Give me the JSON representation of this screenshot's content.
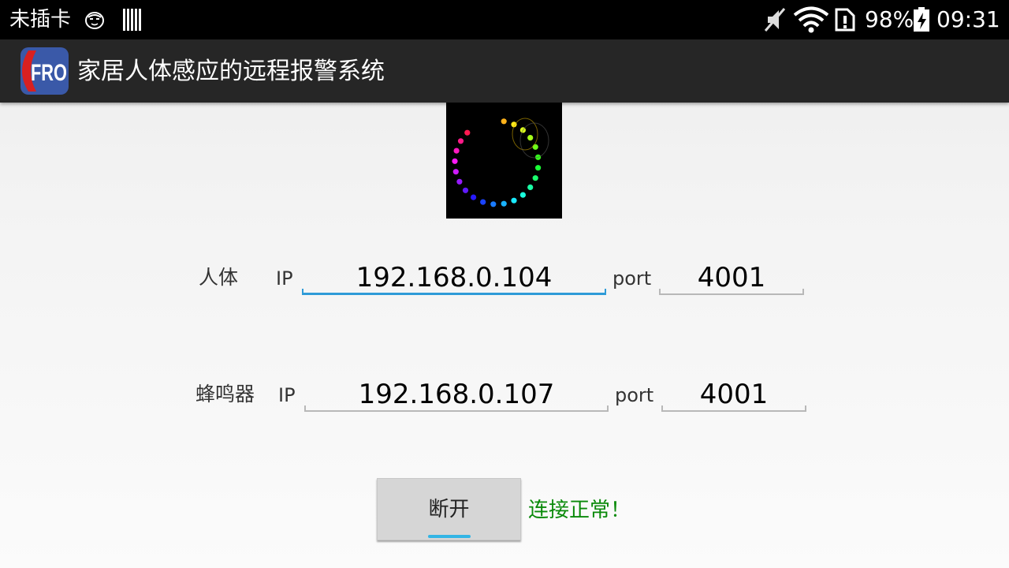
{
  "status_bar": {
    "carrier": "未插卡",
    "battery_percent": "98%",
    "time": "09:31",
    "icons": [
      "face-icon",
      "barcode-icon",
      "mute-icon",
      "wifi-icon",
      "sim-alert-icon",
      "battery-charging-icon"
    ]
  },
  "action_bar": {
    "app_icon": "app-logo-icon",
    "app_icon_text": "FRO",
    "title": "家居人体感应的远程报警系统"
  },
  "loading_indicator": {
    "icon": "spinner-icon"
  },
  "human_sensor": {
    "label": "人体",
    "ip_label": "IP",
    "ip_value": "192.168.0.104",
    "port_label": "port",
    "port_value": "4001"
  },
  "buzzer": {
    "label": "蜂鸣器",
    "ip_label": "IP",
    "ip_value": "192.168.0.107",
    "port_label": "port",
    "port_value": "4001"
  },
  "disconnect_button": {
    "label": "断开"
  },
  "connection_status": {
    "text": "连接正常！",
    "color": "#0a8a0a"
  }
}
